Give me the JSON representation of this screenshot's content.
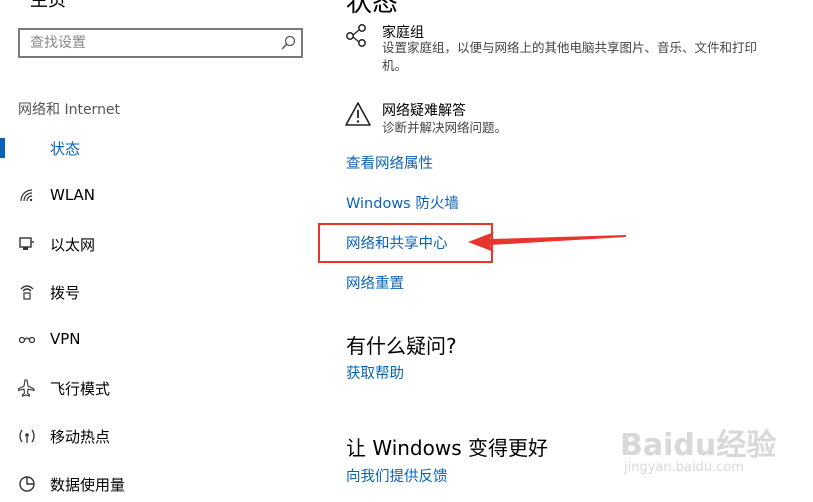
{
  "sidebar": {
    "home_label": "主页",
    "search": {
      "placeholder": "查找设置"
    },
    "section_label": "网络和 Internet",
    "items": [
      {
        "label": "状态",
        "icon": "status-icon",
        "active": true
      },
      {
        "label": "WLAN",
        "icon": "wifi-icon"
      },
      {
        "label": "以太网",
        "icon": "ethernet-icon"
      },
      {
        "label": "拨号",
        "icon": "dialup-icon"
      },
      {
        "label": "VPN",
        "icon": "vpn-icon"
      },
      {
        "label": "飞行模式",
        "icon": "airplane-icon"
      },
      {
        "label": "移动热点",
        "icon": "hotspot-icon"
      },
      {
        "label": "数据使用量",
        "icon": "data-usage-icon"
      }
    ]
  },
  "main": {
    "title": "状态",
    "homegroup": {
      "title": "家庭组",
      "desc_line1": "设置家庭组，以便与网络上的其他电脑共享图片、音乐、文件和打印",
      "desc_line2": "机。"
    },
    "troubleshoot": {
      "title": "网络疑难解答",
      "desc": "诊断并解决网络问题。"
    },
    "links": [
      "查看网络属性",
      "Windows 防火墙",
      "网络和共享中心",
      "网络重置"
    ],
    "questions": {
      "heading": "有什么疑问?",
      "link": "获取帮助"
    },
    "improve": {
      "heading": "让 Windows 变得更好",
      "link": "向我们提供反馈"
    }
  },
  "annotation": {
    "color": "#e8362f"
  },
  "watermark": {
    "line1": "Baidu经验",
    "line2": "jingyan.baidu.com"
  },
  "accent_color": "#0a63b8"
}
